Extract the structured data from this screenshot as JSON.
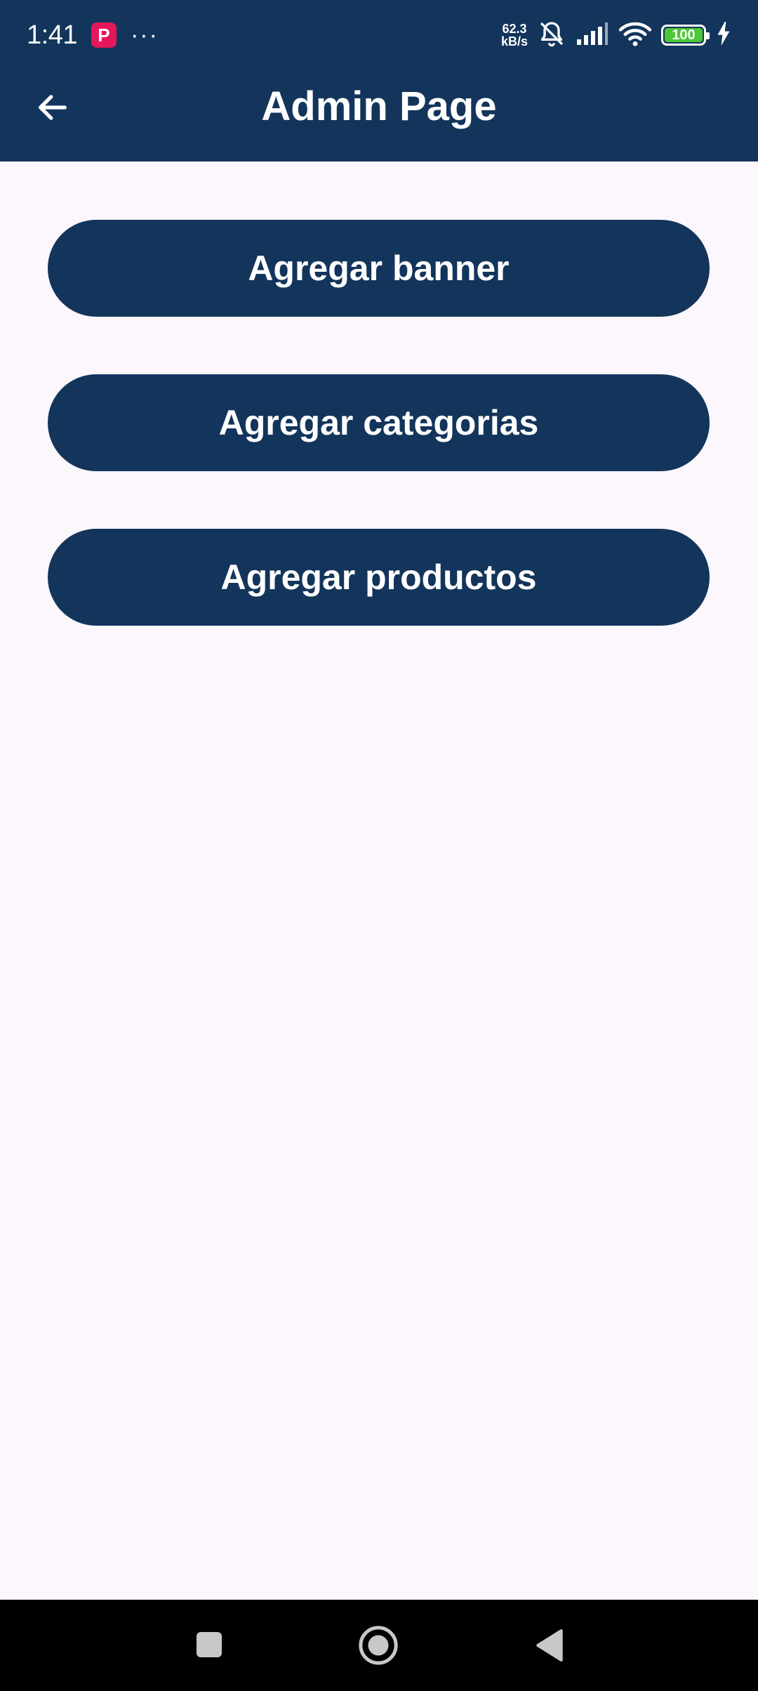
{
  "status_bar": {
    "time": "1:41",
    "app_badge": "P",
    "overflow": "···",
    "net_speed_value": "62.3",
    "net_speed_unit": "kB/s",
    "battery_level": "100",
    "battery_fraction": 1.0
  },
  "app_bar": {
    "title": "Admin Page",
    "back_icon": "arrow-back-icon"
  },
  "actions": [
    {
      "label": "Agregar banner"
    },
    {
      "label": "Agregar categorias"
    },
    {
      "label": "Agregar productos"
    }
  ],
  "nav_bar": {
    "recents_icon": "square-icon",
    "home_icon": "circle-icon",
    "back_icon": "triangle-back-icon"
  },
  "colors": {
    "primary": "#13355b",
    "background": "#fcf6fd",
    "on_primary": "#ffffff",
    "badge": "#e5175a",
    "battery": "#4cc736"
  }
}
